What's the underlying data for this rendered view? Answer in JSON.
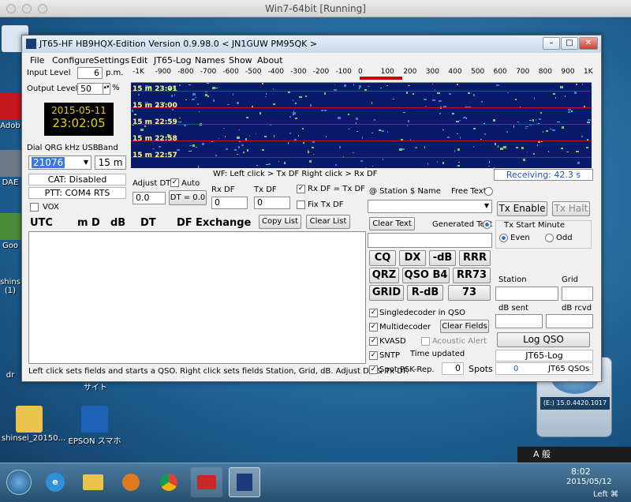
{
  "vm": {
    "title": "Win7-64bit [Running]"
  },
  "desktop": {
    "icons": [
      "Adob",
      "DAE",
      "Goo",
      "shins",
      "(1)",
      "dr",
      "サイト",
      "shinsei_20150...",
      "EPSON スマホ"
    ]
  },
  "window": {
    "title": "JT65-HF HB9HQX-Edition Version 0.9.98.0   < JN1GUW PM95QK >",
    "menu": [
      "File",
      "Configure",
      "Settings",
      "Edit",
      "JT65-Log",
      "Names",
      "Show",
      "About"
    ]
  },
  "left": {
    "input_level_label": "Input Level",
    "input_level": "6",
    "pm": "p.m.",
    "output_level_label": "Output Level",
    "output_level": "50",
    "pct": "%",
    "date": "2015-05-11",
    "time": "23:02:05",
    "dial_label": "Dial QRG kHz USB",
    "band_label": "Band",
    "dial": "21076",
    "band": "15 m",
    "cat": "CAT: Disabled",
    "ptt": "PTT: COM4 RTS",
    "vox": "VOX"
  },
  "scale": {
    "ticks": [
      "-1K",
      "-900",
      "-800",
      "-700",
      "-600",
      "-500",
      "-400",
      "-300",
      "-200",
      "-100",
      "0",
      "100",
      "200",
      "300",
      "400",
      "500",
      "600",
      "700",
      "800",
      "900",
      "1K"
    ]
  },
  "waterfall": {
    "rows": [
      "15 m 23:01",
      "15 m 23:00",
      "15 m 22:59",
      "15 m 22:58",
      "15 m 22:57"
    ],
    "hint": "WF: Left click > Tx DF  Right click > Rx DF",
    "receiving": "Receiving: 42.3 s"
  },
  "controls": {
    "adjust_dt": "Adjust DT",
    "auto": "Auto",
    "dt_value": "0.0",
    "dt_btn": "DT = 0.0",
    "rx_df": "Rx DF",
    "rx_val": "0",
    "tx_df": "Tx DF",
    "tx_val": "0",
    "rxtx": "Rx DF = Tx DF",
    "fix": "Fix Tx DF"
  },
  "decode": {
    "headers": [
      "UTC",
      "m",
      "D",
      "dB",
      "DT",
      "DF",
      "Exchange"
    ],
    "copy": "Copy List",
    "clear": "Clear List",
    "status": "Left click sets fields and starts a QSO. Right click sets fields Station, Grid, dB. Adjust DT & Tx DF."
  },
  "msg": {
    "station_label": "@ Station  $ Name",
    "free_text": "Free Text",
    "clear_text": "Clear Text",
    "generated": "Generated Text",
    "buttons": [
      [
        "CQ",
        "DX",
        "-dB",
        "RRR"
      ],
      [
        "QRZ",
        "QSO B4",
        "RR73"
      ],
      [
        "GRID",
        "R-dB",
        "73"
      ]
    ],
    "single": "Singledecoder in QSO",
    "multi": "Multidecoder",
    "clear_fields": "Clear Fields",
    "kvasd": "KVASD",
    "acoustic": "Acoustic Alert",
    "sntp": "SNTP",
    "time_updated": "Time updated",
    "spot": "Spot PSK-Rep.",
    "spots_count": "0",
    "spots": "Spots"
  },
  "right": {
    "tx_enable": "Tx Enable",
    "tx_halt": "Tx Halt",
    "tx_start": "Tx Start Minute",
    "even": "Even",
    "odd": "Odd",
    "station": "Station",
    "grid": "Grid",
    "db_sent": "dB sent",
    "db_rcvd": "dB rcvd",
    "log_qso": "Log QSO",
    "jt65log": "JT65-Log",
    "qso_count": "0",
    "qsos": "JT65 QSOs"
  },
  "tray": {
    "clock": "8:02",
    "date": "2015/05/12",
    "ime": "A 般",
    "left": "Left ⌘"
  },
  "gadget": {
    "label": "(E:) 15.0.4420.1017"
  }
}
